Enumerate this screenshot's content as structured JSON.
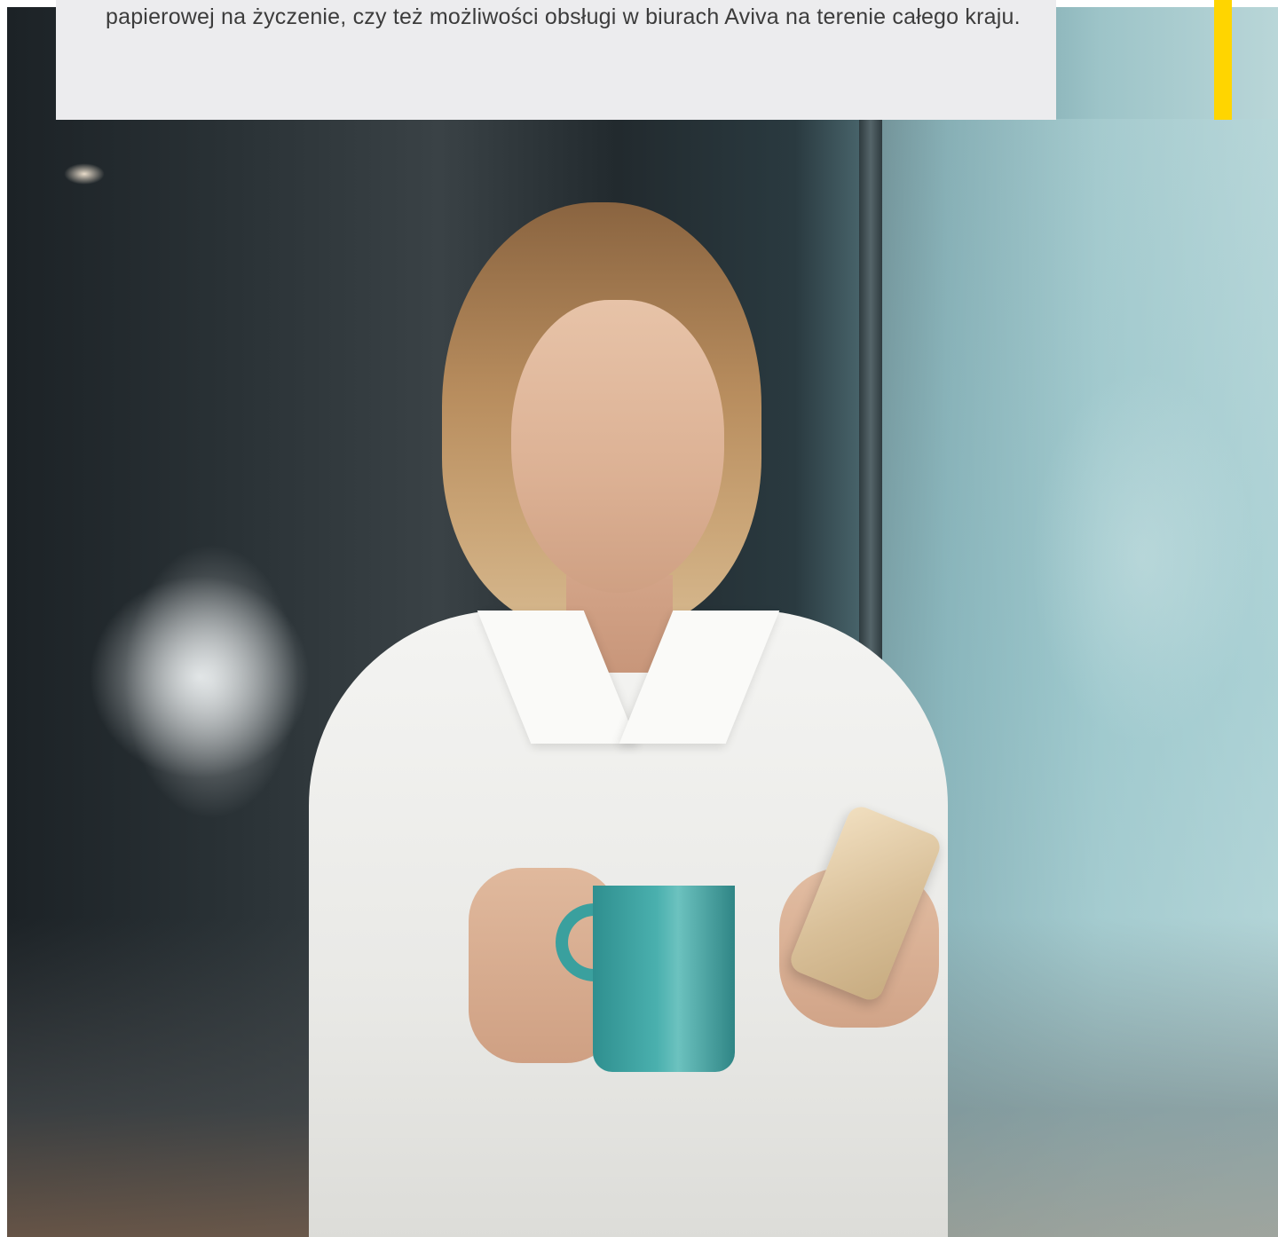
{
  "panel": {
    "text": "papierowej na życzenie, czy też możliwości obsługi w biurach Aviva na terenie całego kraju."
  },
  "colors": {
    "panel_background": "#ececee",
    "accent": "#ffd500",
    "text": "#3c3c3c"
  },
  "hero": {
    "icon": "photo-woman-with-phone-and-mug"
  }
}
